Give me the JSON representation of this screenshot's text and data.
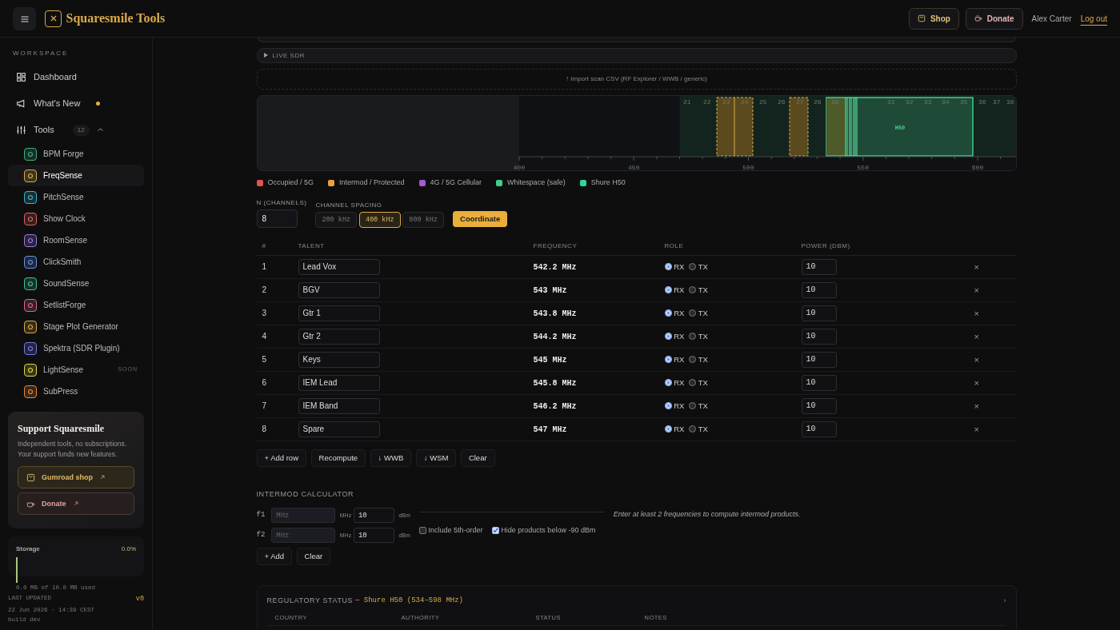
{
  "header": {
    "brand": "Squaresmile Tools",
    "shop": "Shop",
    "donate": "Donate",
    "user": "Alex Carter",
    "logout": "Log out"
  },
  "sidebar": {
    "section": "WORKSPACE",
    "nav": [
      {
        "label": "Dashboard",
        "dot": false
      },
      {
        "label": "What's New",
        "dot": true
      }
    ],
    "tools": {
      "label": "Tools",
      "count": "12",
      "expanded": true,
      "items": [
        {
          "label": "BPM Forge",
          "color": "#3fae7e",
          "selected": false
        },
        {
          "label": "FreqSense",
          "color": "#d9a94a",
          "selected": true
        },
        {
          "label": "PitchSense",
          "color": "#3fb3c9",
          "selected": false
        },
        {
          "label": "Show Clock",
          "color": "#d9655a",
          "selected": false
        },
        {
          "label": "RoomSense",
          "color": "#9a7ae0",
          "selected": false
        },
        {
          "label": "ClickSmith",
          "color": "#6a8fe0",
          "selected": false
        },
        {
          "label": "SoundSense",
          "color": "#3fc48a",
          "selected": false
        },
        {
          "label": "SetlistForge",
          "color": "#d9658f",
          "selected": false
        },
        {
          "label": "Stage Plot Generator",
          "color": "#d9a94a",
          "selected": false
        },
        {
          "label": "Spektra (SDR Plugin)",
          "color": "#7a7ae0",
          "selected": false
        },
        {
          "label": "LightSense",
          "color": "#d9d94a",
          "badge": "SOON",
          "selected": false
        },
        {
          "label": "SubPress",
          "color": "#e8893d",
          "selected": false
        }
      ]
    },
    "support": {
      "title": "Support Squaresmile",
      "text": "Independent tools, no subscriptions. Your support funds new features.",
      "shop": "Gumroad shop",
      "donate": "Donate"
    },
    "storage": {
      "label": "Storage",
      "percent": "0.0%",
      "used": "0.0 MB of 10.0 MB used"
    },
    "footer": {
      "updated_label": "LAST UPDATED",
      "version": "v0",
      "date": "22 Jun 2026 · 14:39 CEST",
      "build": "build dev"
    }
  },
  "main": {
    "live_sdr": "LIVE SDR",
    "import": "↑ Import scan CSV (RF Explorer / WWB / generic)",
    "spectrum": {
      "channel_labels": [
        "21",
        "22",
        "23",
        "24",
        "25",
        "26",
        "27",
        "28",
        "29",
        "31",
        "32",
        "33",
        "34",
        "35",
        "36",
        "37",
        "38"
      ],
      "band_label": "H50",
      "axis_labels": [
        "400",
        "450",
        "500",
        "550",
        "600"
      ]
    },
    "legend": [
      {
        "label": "Occupied / 5G",
        "color": "#e5534b"
      },
      {
        "label": "Intermod / Protected",
        "color": "#e8a33d"
      },
      {
        "label": "4G / 5G Cellular",
        "color": "#a35ad8"
      },
      {
        "label": "Whitespace (safe)",
        "color": "#3ecf8e"
      },
      {
        "label": "Shure H50",
        "color": "#34d399"
      }
    ],
    "n_label": "N (CHANNELS)",
    "n_value": "8",
    "spacing_label": "CHANNEL SPACING",
    "spacing": [
      {
        "label": "200 kHz",
        "selected": false
      },
      {
        "label": "400 kHz",
        "selected": true
      },
      {
        "label": "800 kHz",
        "selected": false
      }
    ],
    "coordinate": "Coordinate",
    "table": {
      "columns": [
        "#",
        "TALENT",
        "FREQUENCY",
        "ROLE",
        "POWER (DBM)"
      ],
      "rows": [
        {
          "n": "1",
          "talent": "Lead Vox",
          "freq": "542.2 MHz",
          "roles": [
            {
              "label": "RX",
              "selected": true
            },
            {
              "label": "TX",
              "selected": false
            }
          ],
          "power": "10",
          "remove": "×"
        },
        {
          "n": "2",
          "talent": "BGV",
          "freq": "543 MHz",
          "roles": [
            {
              "label": "RX",
              "selected": true
            },
            {
              "label": "TX",
              "selected": false
            }
          ],
          "power": "10",
          "remove": "×"
        },
        {
          "n": "3",
          "talent": "Gtr 1",
          "freq": "543.8 MHz",
          "roles": [
            {
              "label": "RX",
              "selected": true
            },
            {
              "label": "TX",
              "selected": false
            }
          ],
          "power": "10",
          "remove": "×"
        },
        {
          "n": "4",
          "talent": "Gtr 2",
          "freq": "544.2 MHz",
          "roles": [
            {
              "label": "RX",
              "selected": true
            },
            {
              "label": "TX",
              "selected": false
            }
          ],
          "power": "10",
          "remove": "×"
        },
        {
          "n": "5",
          "talent": "Keys",
          "freq": "545 MHz",
          "roles": [
            {
              "label": "RX",
              "selected": true
            },
            {
              "label": "TX",
              "selected": false
            }
          ],
          "power": "10",
          "remove": "×"
        },
        {
          "n": "6",
          "talent": "IEM Lead",
          "freq": "545.8 MHz",
          "roles": [
            {
              "label": "RX",
              "selected": true
            },
            {
              "label": "TX",
              "selected": false
            }
          ],
          "power": "10",
          "remove": "×"
        },
        {
          "n": "7",
          "talent": "IEM Band",
          "freq": "546.2 MHz",
          "roles": [
            {
              "label": "RX",
              "selected": true
            },
            {
              "label": "TX",
              "selected": false
            }
          ],
          "power": "10",
          "remove": "×"
        },
        {
          "n": "8",
          "talent": "Spare",
          "freq": "547 MHz",
          "roles": [
            {
              "label": "RX",
              "selected": true
            },
            {
              "label": "TX",
              "selected": false
            }
          ],
          "power": "10",
          "remove": "×"
        }
      ]
    },
    "actions": [
      "+ Add row",
      "Recompute",
      "↓ WWB",
      "↓ WSM",
      "Clear"
    ],
    "intermod": {
      "title": "INTERMOD CALCULATOR",
      "inputs": [
        {
          "label": "f1",
          "placeholder": "MHz",
          "unit": "MHz",
          "power": "10",
          "power_unit": "dBm"
        },
        {
          "label": "f2",
          "placeholder": "MHz",
          "unit": "MHz",
          "power": "10",
          "power_unit": "dBm"
        }
      ],
      "options": [
        {
          "label": "Include 5th-order",
          "checked": false
        },
        {
          "label": "Hide products below -90 dBm",
          "checked": true
        }
      ],
      "hint": "Enter at least 2 frequencies to compute intermod products.",
      "buttons": [
        "+ Add",
        "Clear"
      ]
    },
    "regulatory": {
      "title": "REGULATORY STATUS",
      "subtitle": "— Shure H50 (534–598 MHz)",
      "toggle": "›",
      "columns": [
        "COUNTRY",
        "AUTHORITY",
        "STATUS",
        "NOTES"
      ]
    }
  }
}
